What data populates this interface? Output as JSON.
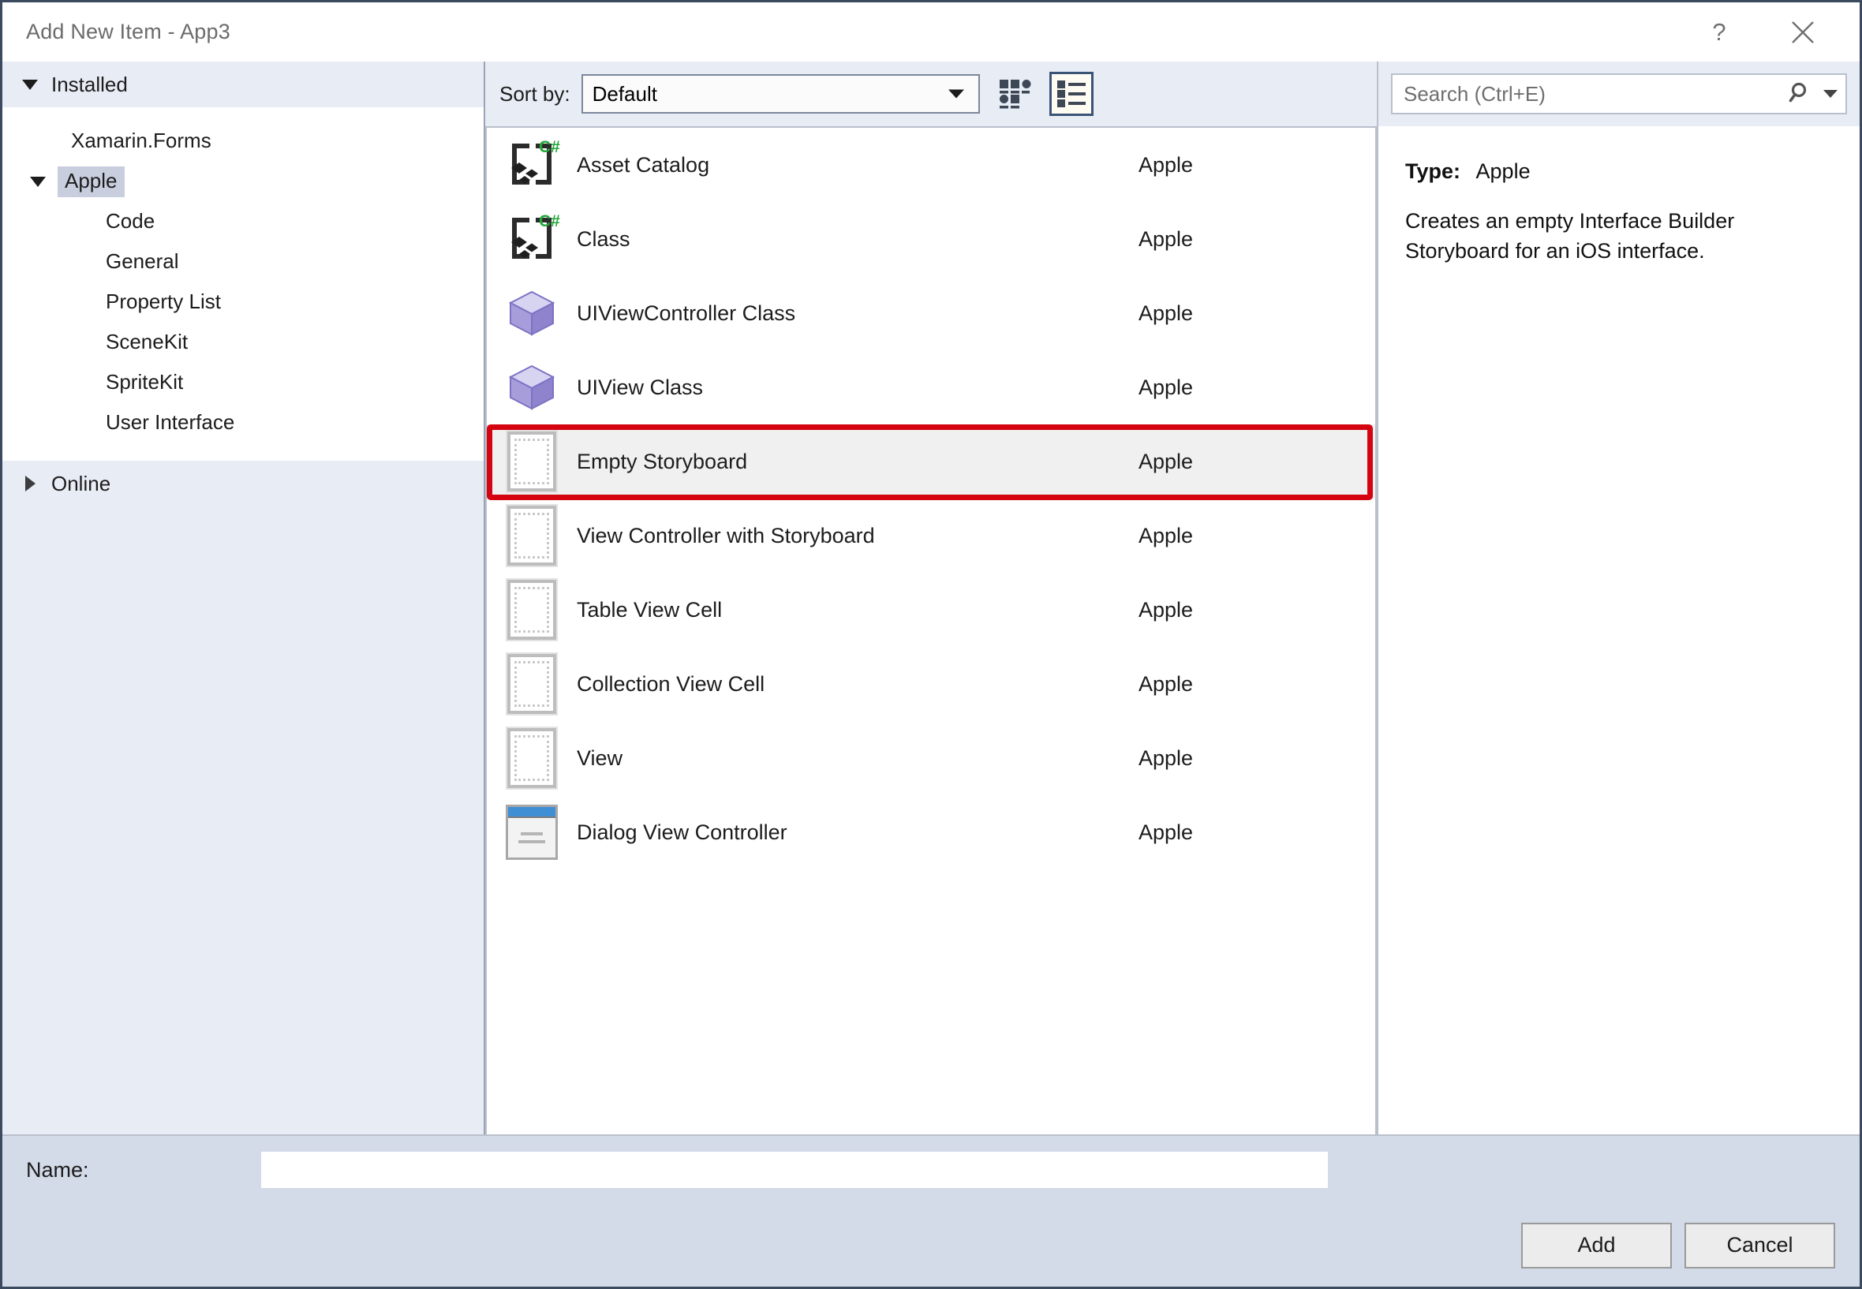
{
  "window": {
    "title": "Add New Item - App3",
    "help_icon": "question-mark-icon",
    "close_icon": "close-icon"
  },
  "sidebar": {
    "groups": [
      {
        "label": "Installed",
        "expanded": true,
        "icon": "triangle-down-icon"
      },
      {
        "label": "Online",
        "expanded": false,
        "icon": "triangle-right-icon"
      }
    ],
    "tree": [
      {
        "label": "Xamarin.Forms",
        "level": 1,
        "selected": false,
        "expandable": false
      },
      {
        "label": "Apple",
        "level": 1,
        "selected": true,
        "expandable": true,
        "icon": "triangle-down-icon"
      },
      {
        "label": "Code",
        "level": 2,
        "selected": false,
        "expandable": false
      },
      {
        "label": "General",
        "level": 2,
        "selected": false,
        "expandable": false
      },
      {
        "label": "Property List",
        "level": 2,
        "selected": false,
        "expandable": false
      },
      {
        "label": "SceneKit",
        "level": 2,
        "selected": false,
        "expandable": false
      },
      {
        "label": "SpriteKit",
        "level": 2,
        "selected": false,
        "expandable": false
      },
      {
        "label": "User Interface",
        "level": 2,
        "selected": false,
        "expandable": false
      }
    ]
  },
  "toolbar": {
    "sort_label": "Sort by:",
    "sort_value": "Default",
    "sort_options": [
      "Default"
    ],
    "grid_view_icon": "grid-view-icon",
    "list_view_icon": "list-view-icon",
    "active_view": "list"
  },
  "search": {
    "placeholder": "Search (Ctrl+E)",
    "value": "",
    "icon": "search-icon",
    "dropdown_icon": "chevron-down-icon"
  },
  "items": [
    {
      "name": "Asset Catalog",
      "origin": "Apple",
      "icon": "csharp-class-icon",
      "selected": false
    },
    {
      "name": "Class",
      "origin": "Apple",
      "icon": "csharp-class-icon",
      "selected": false
    },
    {
      "name": "UIViewController Class",
      "origin": "Apple",
      "icon": "purple-cube-icon",
      "selected": false
    },
    {
      "name": "UIView Class",
      "origin": "Apple",
      "icon": "purple-cube-icon",
      "selected": false
    },
    {
      "name": "Empty Storyboard",
      "origin": "Apple",
      "icon": "storyboard-icon",
      "selected": true
    },
    {
      "name": "View Controller with Storyboard",
      "origin": "Apple",
      "icon": "storyboard-icon",
      "selected": false
    },
    {
      "name": "Table View Cell",
      "origin": "Apple",
      "icon": "storyboard-icon",
      "selected": false
    },
    {
      "name": "Collection View Cell",
      "origin": "Apple",
      "icon": "storyboard-icon",
      "selected": false
    },
    {
      "name": "View",
      "origin": "Apple",
      "icon": "storyboard-icon",
      "selected": false
    },
    {
      "name": "Dialog View Controller",
      "origin": "Apple",
      "icon": "dialog-window-icon",
      "selected": false
    }
  ],
  "details": {
    "type_label": "Type:",
    "type_value": "Apple",
    "description": "Creates an empty Interface Builder Storyboard for an iOS interface."
  },
  "footer": {
    "name_label": "Name:",
    "name_value": "",
    "name_placeholder": "",
    "add_label": "Add",
    "cancel_label": "Cancel"
  },
  "annotation": {
    "target": "Empty Storyboard",
    "color": "#d40511"
  },
  "colors": {
    "dialog_chrome": "#e8ecf5",
    "footer_bar": "#d3dae8",
    "selection": "#c9cede",
    "row_selected": "#f0f0f0",
    "annotation_red": "#d40511"
  }
}
